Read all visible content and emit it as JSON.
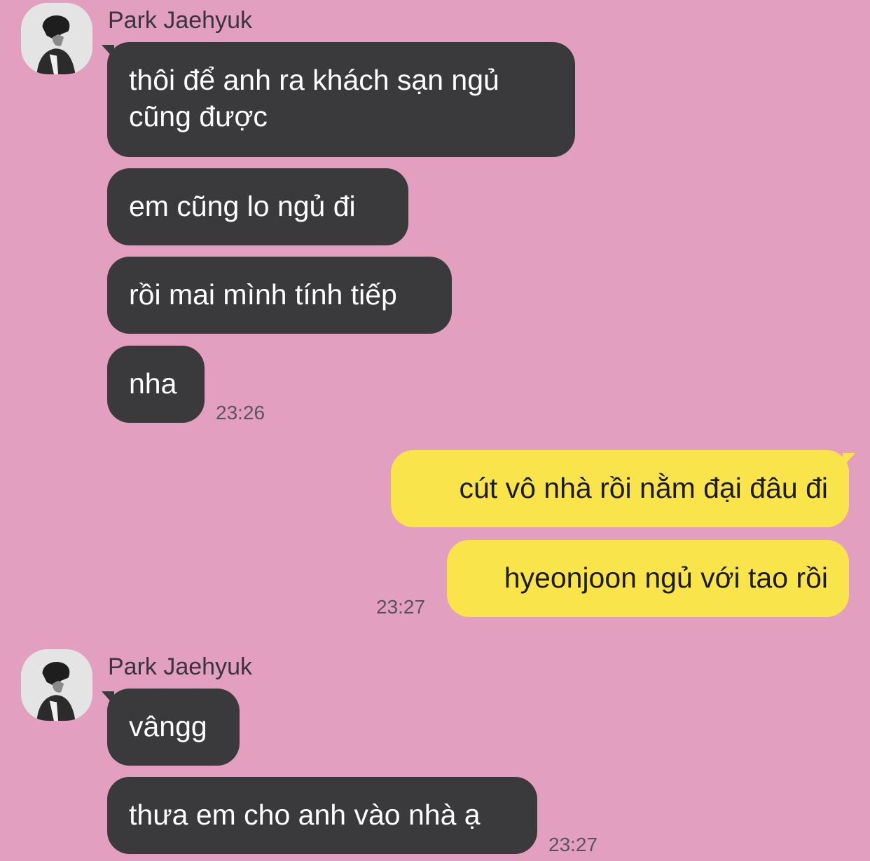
{
  "chat": {
    "groups": [
      {
        "sender": "Park Jaehyuk",
        "avatar_icon": "profile-photo-avatar",
        "messages": [
          "thôi để anh ra khách sạn ngủ",
          "cũng được",
          "em cũng lo ngủ đi",
          "rồi mai mình tính tiếp",
          "nha"
        ],
        "time": "23:26"
      },
      {
        "sender": "me",
        "messages": [
          "cút vô nhà rồi nằm đại đâu đi",
          "hyeonjoon ngủ với tao rồi"
        ],
        "time": "23:27"
      },
      {
        "sender": "Park Jaehyuk",
        "avatar_icon": "profile-photo-avatar",
        "messages": [
          "vângg",
          "thưa em cho anh vào nhà ạ"
        ],
        "time": "23:27"
      }
    ]
  },
  "colors": {
    "background": "#e39fc0",
    "incoming_bubble": "#3a3a3c",
    "outgoing_bubble": "#f9e54b"
  }
}
